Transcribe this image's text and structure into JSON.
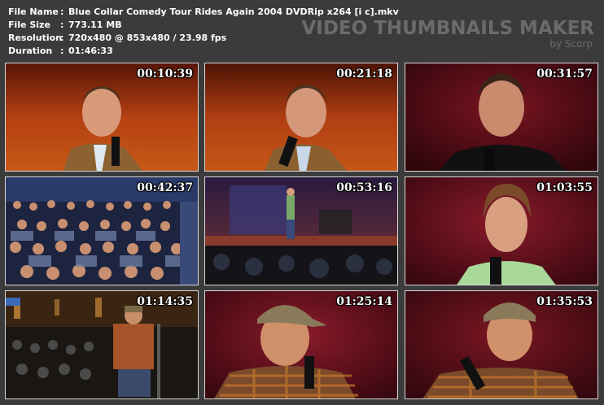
{
  "info": {
    "rows": [
      {
        "label": "File Name",
        "value": "Blue Collar Comedy Tour Rides Again 2004 DVDRip x264 [i c].mkv"
      },
      {
        "label": "File Size",
        "value": "773.11 MB"
      },
      {
        "label": "Resolution",
        "value": "720x480 @ 853x480 / 23.98 fps"
      },
      {
        "label": "Duration",
        "value": "01:46:33"
      }
    ],
    "separator": ":"
  },
  "brand": {
    "title": "VIDEO THUMBNAILS MAKER",
    "subtitle": "by Scorp"
  },
  "thumbnails": [
    {
      "timestamp": "00:10:39",
      "scene": "comedian-closeup-orange"
    },
    {
      "timestamp": "00:21:18",
      "scene": "comedian-mic-orange"
    },
    {
      "timestamp": "00:31:57",
      "scene": "comedian-dark-red"
    },
    {
      "timestamp": "00:42:37",
      "scene": "audience"
    },
    {
      "timestamp": "00:53:16",
      "scene": "stage-wide"
    },
    {
      "timestamp": "01:03:55",
      "scene": "comedian-green-shirt"
    },
    {
      "timestamp": "01:14:35",
      "scene": "stage-back-view"
    },
    {
      "timestamp": "01:25:14",
      "scene": "comedian-cap"
    },
    {
      "timestamp": "01:35:53",
      "scene": "comedian-cap-mic"
    }
  ]
}
